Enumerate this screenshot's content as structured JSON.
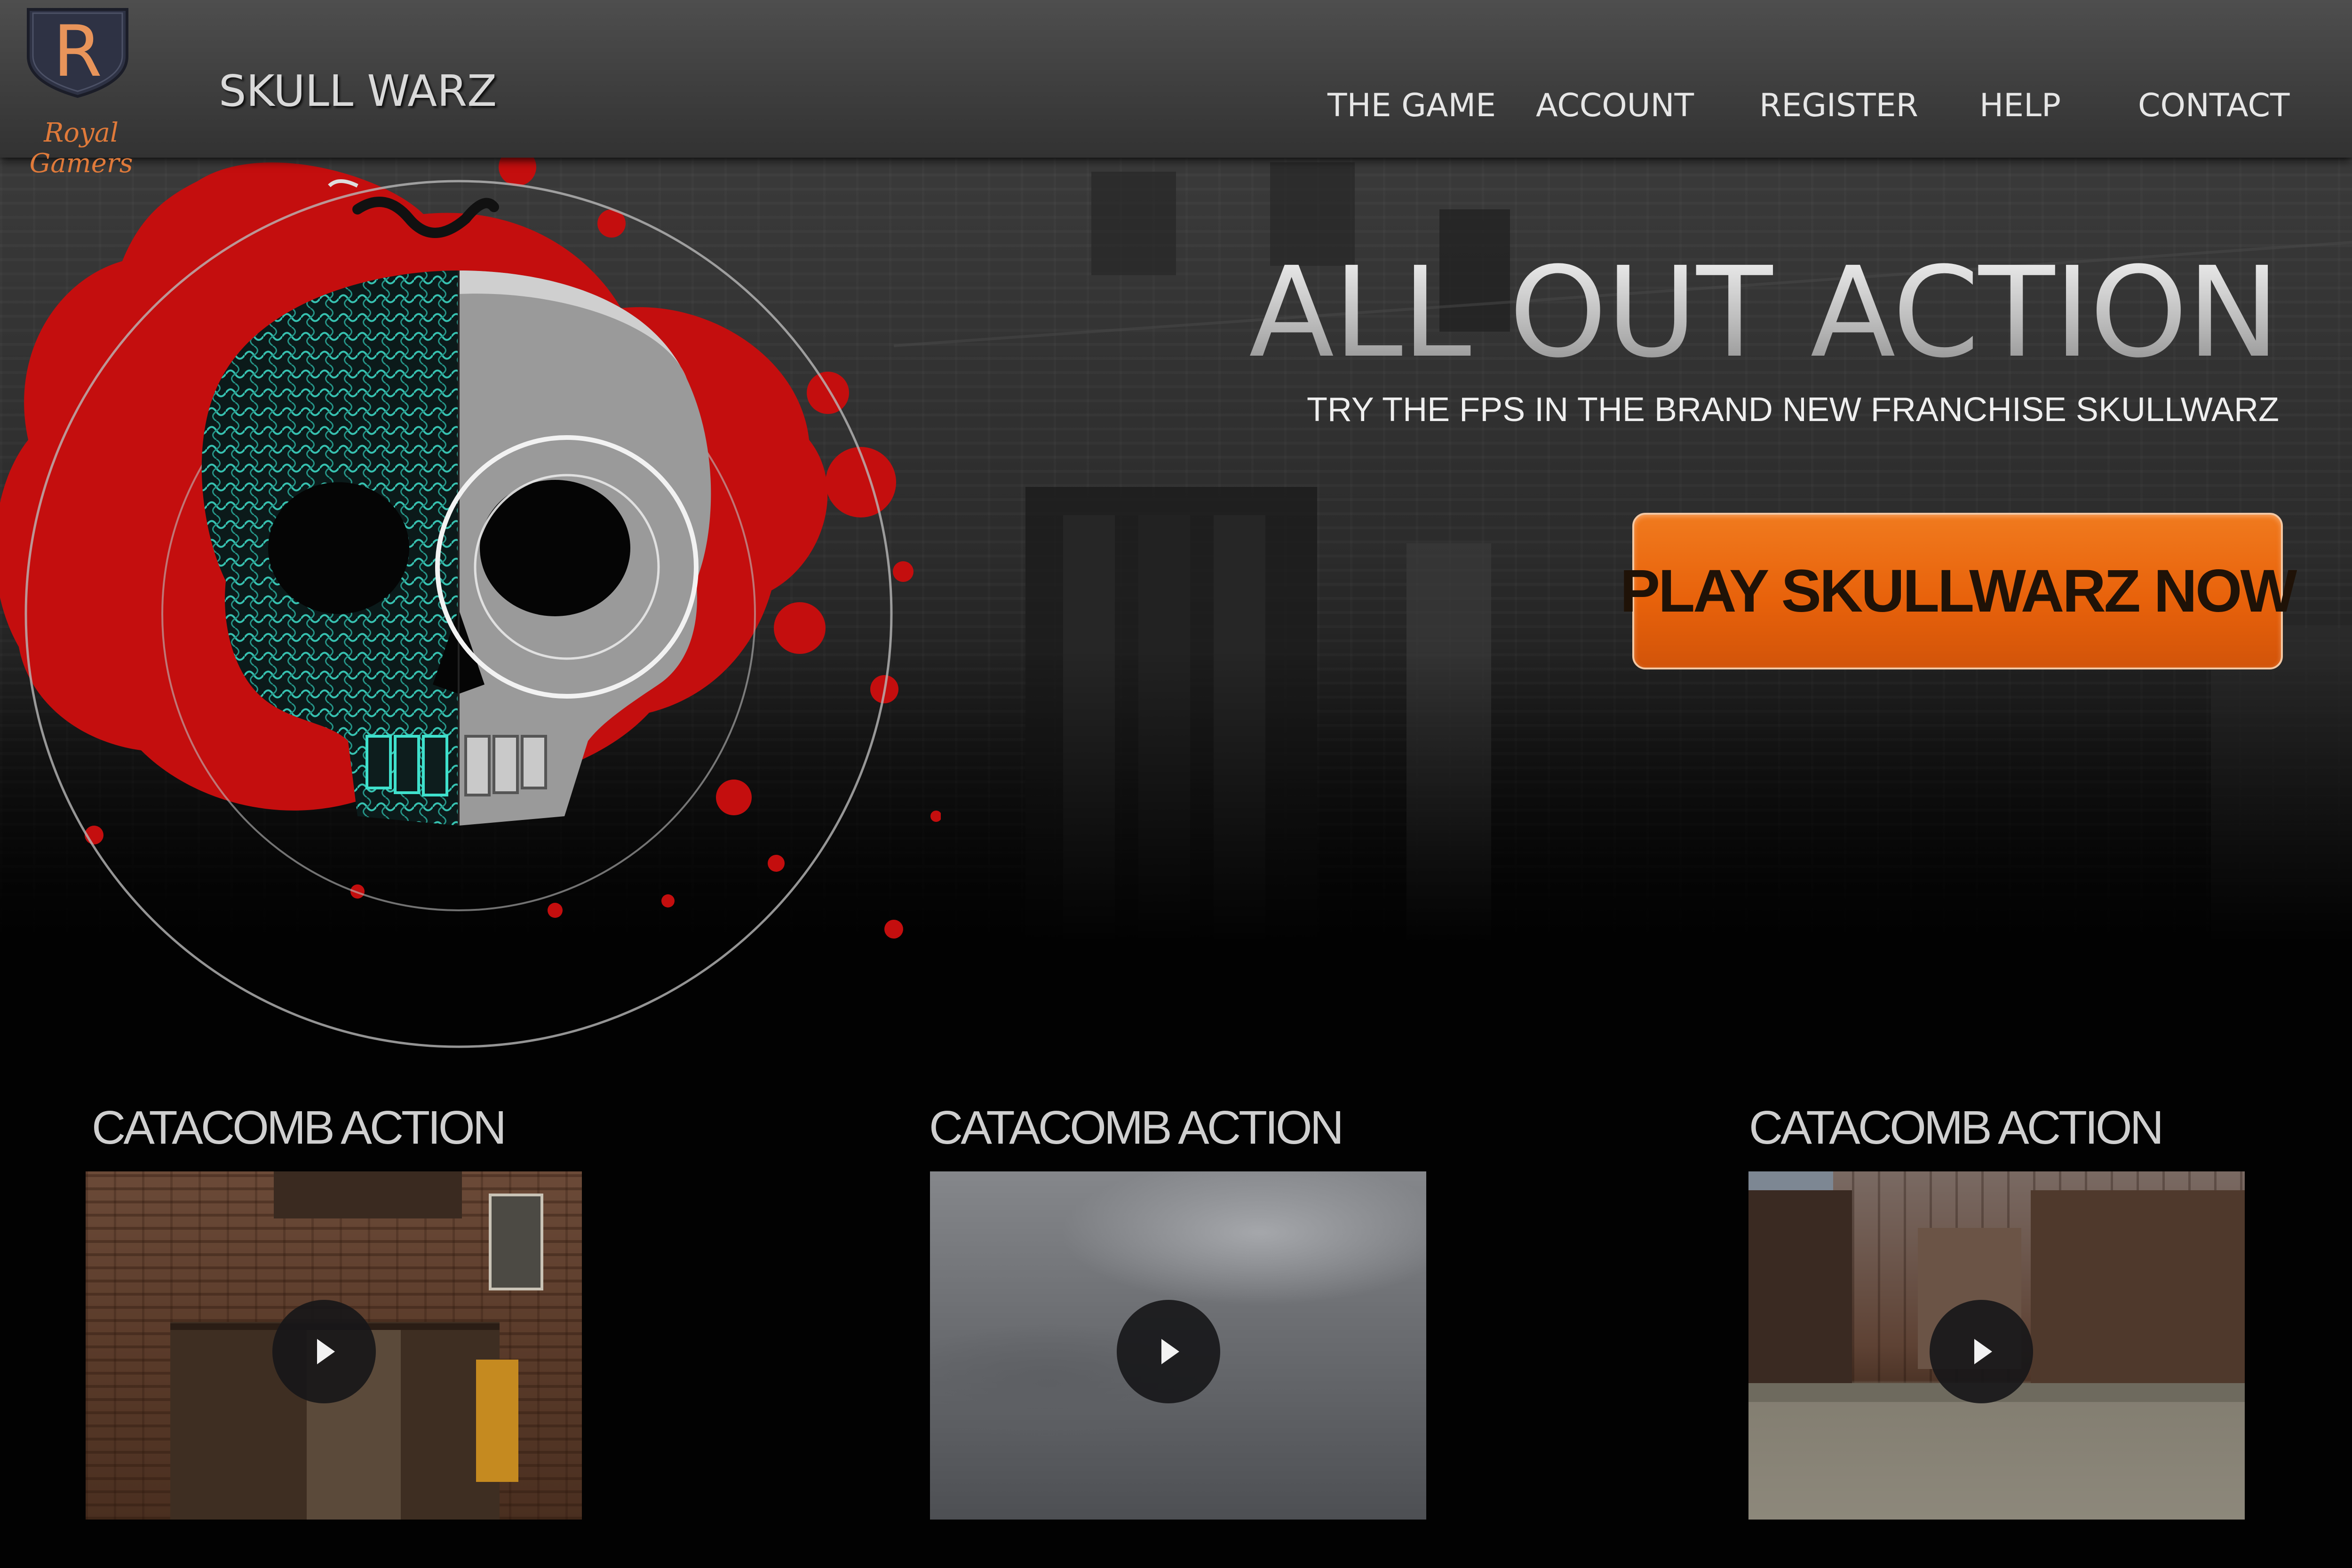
{
  "brand": {
    "logo_letter": "R",
    "logo_text": "Royal Gamers",
    "site_title": "SKULL WARZ"
  },
  "nav": {
    "items": [
      {
        "label": "THE GAME"
      },
      {
        "label": "ACCOUNT"
      },
      {
        "label": "REGISTER"
      },
      {
        "label": "HELP"
      },
      {
        "label": "CONTACT"
      }
    ]
  },
  "hero": {
    "title": "ALL OUT ACTION",
    "subtitle": "TRY THE FPS IN THE BRAND NEW FRANCHISE SKULLWARZ",
    "cta_label": "PLAY SKULLWARZ NOW"
  },
  "videos": [
    {
      "title": "CATACOMB ACTION",
      "icon": "play-icon"
    },
    {
      "title": "CATACOMB ACTION",
      "icon": "play-icon"
    },
    {
      "title": "CATACOMB ACTION",
      "icon": "play-icon"
    }
  ],
  "colors": {
    "header_bg": "#3d3d3d",
    "accent_orange": "#e8620b",
    "blood_red": "#c40e0e",
    "skull_teal": "#3fe0cc"
  }
}
